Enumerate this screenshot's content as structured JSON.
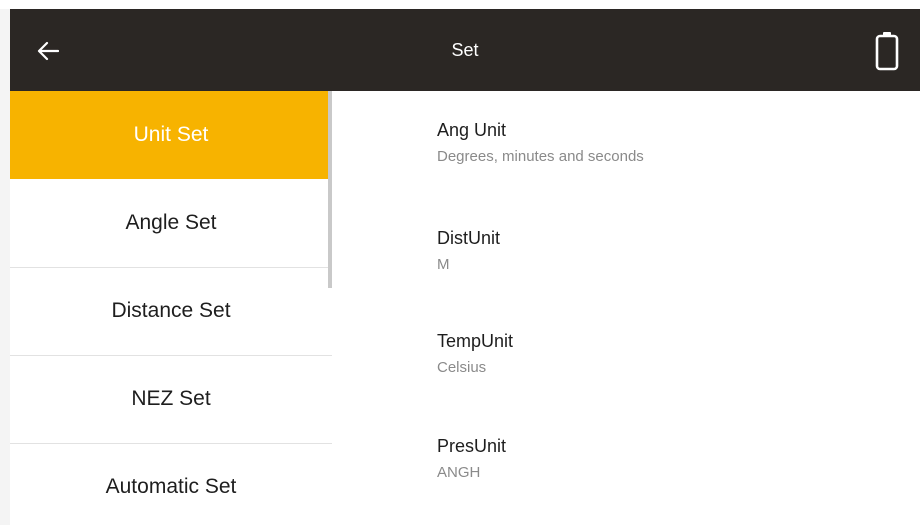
{
  "header": {
    "title": "Set",
    "back_icon": "arrow-left-icon",
    "battery_icon": "battery-icon",
    "bar_color": "#2b2724"
  },
  "sidebar": {
    "accent_color": "#f7b300",
    "items": [
      {
        "label": "Unit Set",
        "active": true
      },
      {
        "label": "Angle Set",
        "active": false
      },
      {
        "label": "Distance Set",
        "active": false
      },
      {
        "label": "NEZ Set",
        "active": false
      },
      {
        "label": "Automatic Set",
        "active": false
      }
    ]
  },
  "settings": [
    {
      "label": "Ang Unit",
      "value": "Degrees, minutes and seconds"
    },
    {
      "label": "DistUnit",
      "value": "M"
    },
    {
      "label": "TempUnit",
      "value": "Celsius"
    },
    {
      "label": "PresUnit",
      "value": "ANGH"
    }
  ]
}
